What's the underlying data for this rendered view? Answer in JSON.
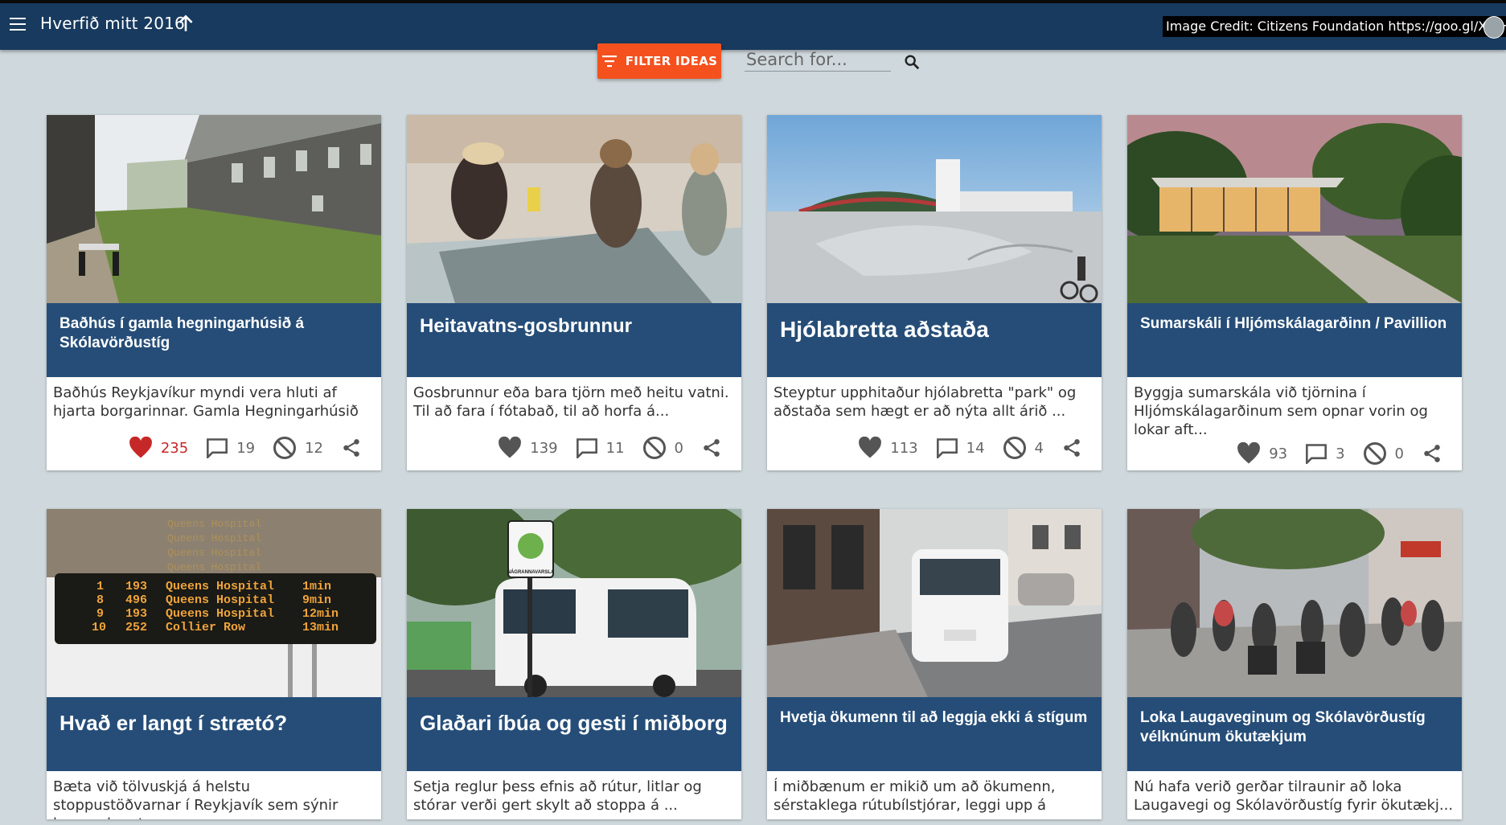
{
  "appbar": {
    "title": "Hverfið mitt 2016",
    "image_credit": "Image Credit: Citizens Foundation https://goo.gl/XKJHRA"
  },
  "toolbar": {
    "filter_label": "FILTER IDEAS",
    "search_placeholder": "Search for..."
  },
  "colors": {
    "appbar": "#173a5e",
    "card_header": "#254d78",
    "filter_button": "#f4511e",
    "liked_heart": "#c62828",
    "background": "#cfd8dc"
  },
  "ideas": [
    {
      "title": "Baðhús í gamla hegningarhúsið á Skólavörðustíg",
      "description": "Baðhús Reykjavíkur myndi vera hluti af hjarta borgarinnar. Gamla Hegningarhúsið ...",
      "likes": "235",
      "comments": "19",
      "dislikes": "12",
      "liked": true
    },
    {
      "title": "Heitavatns-gosbrunnur",
      "description": "Gosbrunnur eða bara tjörn með heitu vatni. Til að fara í fótabað, til að horfa á...",
      "likes": "139",
      "comments": "11",
      "dislikes": "0",
      "liked": false
    },
    {
      "title": "Hjólabretta aðstaða",
      "description": "Steyptur upphitaður hjólabretta \"park\" og aðstaða sem hægt er að nýta allt árið ...",
      "likes": "113",
      "comments": "14",
      "dislikes": "4",
      "liked": false
    },
    {
      "title": "Sumarskáli í Hljómskálagarðinn / Pavillion",
      "description": "Byggja sumarskála við tjörnina í Hljómskálagarðinum sem opnar vorin og lokar aft...",
      "likes": "93",
      "comments": "3",
      "dislikes": "0",
      "liked": false
    },
    {
      "title": "Hvað er langt í strætó?",
      "description": "Bæta við tölvuskjá á helstu stoppustöðvarnar í Reykjavík sem sýnir hversu langt ..."
    },
    {
      "title": "Glaðari íbúa og gesti í miðborg",
      "description": "Setja reglur þess efnis að rútur, litlar og stórar verði gert skylt að stoppa á ..."
    },
    {
      "title": "Hvetja ökumenn til að leggja ekki á stígum",
      "description": "Í miðbænum er mikið um að ökumenn, sérstaklega rútubílstjórar, leggi upp á gangs..."
    },
    {
      "title": "Loka Laugaveginum og Skólavörðustíg vélknúnum ökutækjum",
      "description": "Nú hafa verið gerðar tilraunir að loka Laugavegi og Skólavörðustíg fyrir ökutækj..."
    }
  ],
  "bus_display": {
    "rows": [
      {
        "num": "1",
        "route": "193",
        "dest": "Queens Hospital",
        "time": "1min"
      },
      {
        "num": "8",
        "route": "496",
        "dest": "Queens Hospital",
        "time": "9min"
      },
      {
        "num": "9",
        "route": "193",
        "dest": "Queens Hospital",
        "time": "12min"
      },
      {
        "num": "10",
        "route": "252",
        "dest": "Collier Row",
        "time": "13min"
      }
    ]
  },
  "bus_stop_sign": "NÁGRANNAVARSLA",
  "icons": [
    "menu-icon",
    "arrow-up-icon",
    "filter-icon",
    "search-icon",
    "heart-icon",
    "comment-icon",
    "block-icon",
    "share-icon"
  ]
}
